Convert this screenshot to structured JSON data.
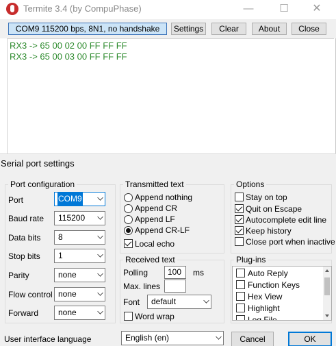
{
  "window": {
    "title": "Termite 3.4 (by CompuPhase)",
    "minimize": "—",
    "maximize": "☐",
    "close": "✕"
  },
  "toolbar": {
    "status": "COM9 115200 bps, 8N1, no handshake",
    "settings": "Settings",
    "clear": "Clear",
    "about": "About",
    "close": "Close"
  },
  "terminal": {
    "lines": [
      "RX3 -> 65 00 02 00 FF FF FF",
      "RX3 -> 65 00 03 00 FF FF FF"
    ],
    "text_color": "#2e8b2e"
  },
  "dialog": {
    "title": "Serial port settings",
    "port_config": {
      "legend": "Port configuration",
      "fields": [
        {
          "label": "Port",
          "value": "COM9"
        },
        {
          "label": "Baud rate",
          "value": "115200"
        },
        {
          "label": "Data bits",
          "value": "8"
        },
        {
          "label": "Stop bits",
          "value": "1"
        },
        {
          "label": "Parity",
          "value": "none"
        },
        {
          "label": "Flow control",
          "value": "none"
        },
        {
          "label": "Forward",
          "value": "none"
        }
      ]
    },
    "transmitted": {
      "legend": "Transmitted text",
      "options": [
        "Append nothing",
        "Append CR",
        "Append LF",
        "Append CR-LF"
      ],
      "selected": "Append CR-LF",
      "local_echo": {
        "label": "Local echo",
        "checked": true
      }
    },
    "received": {
      "legend": "Received text",
      "polling_label": "Polling",
      "polling_value": "100",
      "polling_unit": "ms",
      "max_lines_label": "Max. lines",
      "max_lines_value": "",
      "font_label": "Font",
      "font_value": "default",
      "word_wrap": {
        "label": "Word wrap",
        "checked": false
      }
    },
    "options": {
      "legend": "Options",
      "items": [
        {
          "label": "Stay on top",
          "checked": false
        },
        {
          "label": "Quit on Escape",
          "checked": true
        },
        {
          "label": "Autocomplete edit line",
          "checked": true
        },
        {
          "label": "Keep history",
          "checked": true
        },
        {
          "label": "Close port when inactive",
          "checked": false
        }
      ]
    },
    "plugins": {
      "legend": "Plug-ins",
      "items": [
        {
          "label": "Auto Reply",
          "checked": false
        },
        {
          "label": "Function Keys",
          "checked": false
        },
        {
          "label": "Hex View",
          "checked": false
        },
        {
          "label": "Highlight",
          "checked": false
        },
        {
          "label": "Log File",
          "checked": false
        }
      ]
    },
    "ui_language_label": "User interface language",
    "ui_language_value": "English (en)",
    "cancel": "Cancel",
    "ok": "OK"
  },
  "colors": {
    "status_bg": "#cce4f7",
    "accent": "#0078d7"
  }
}
